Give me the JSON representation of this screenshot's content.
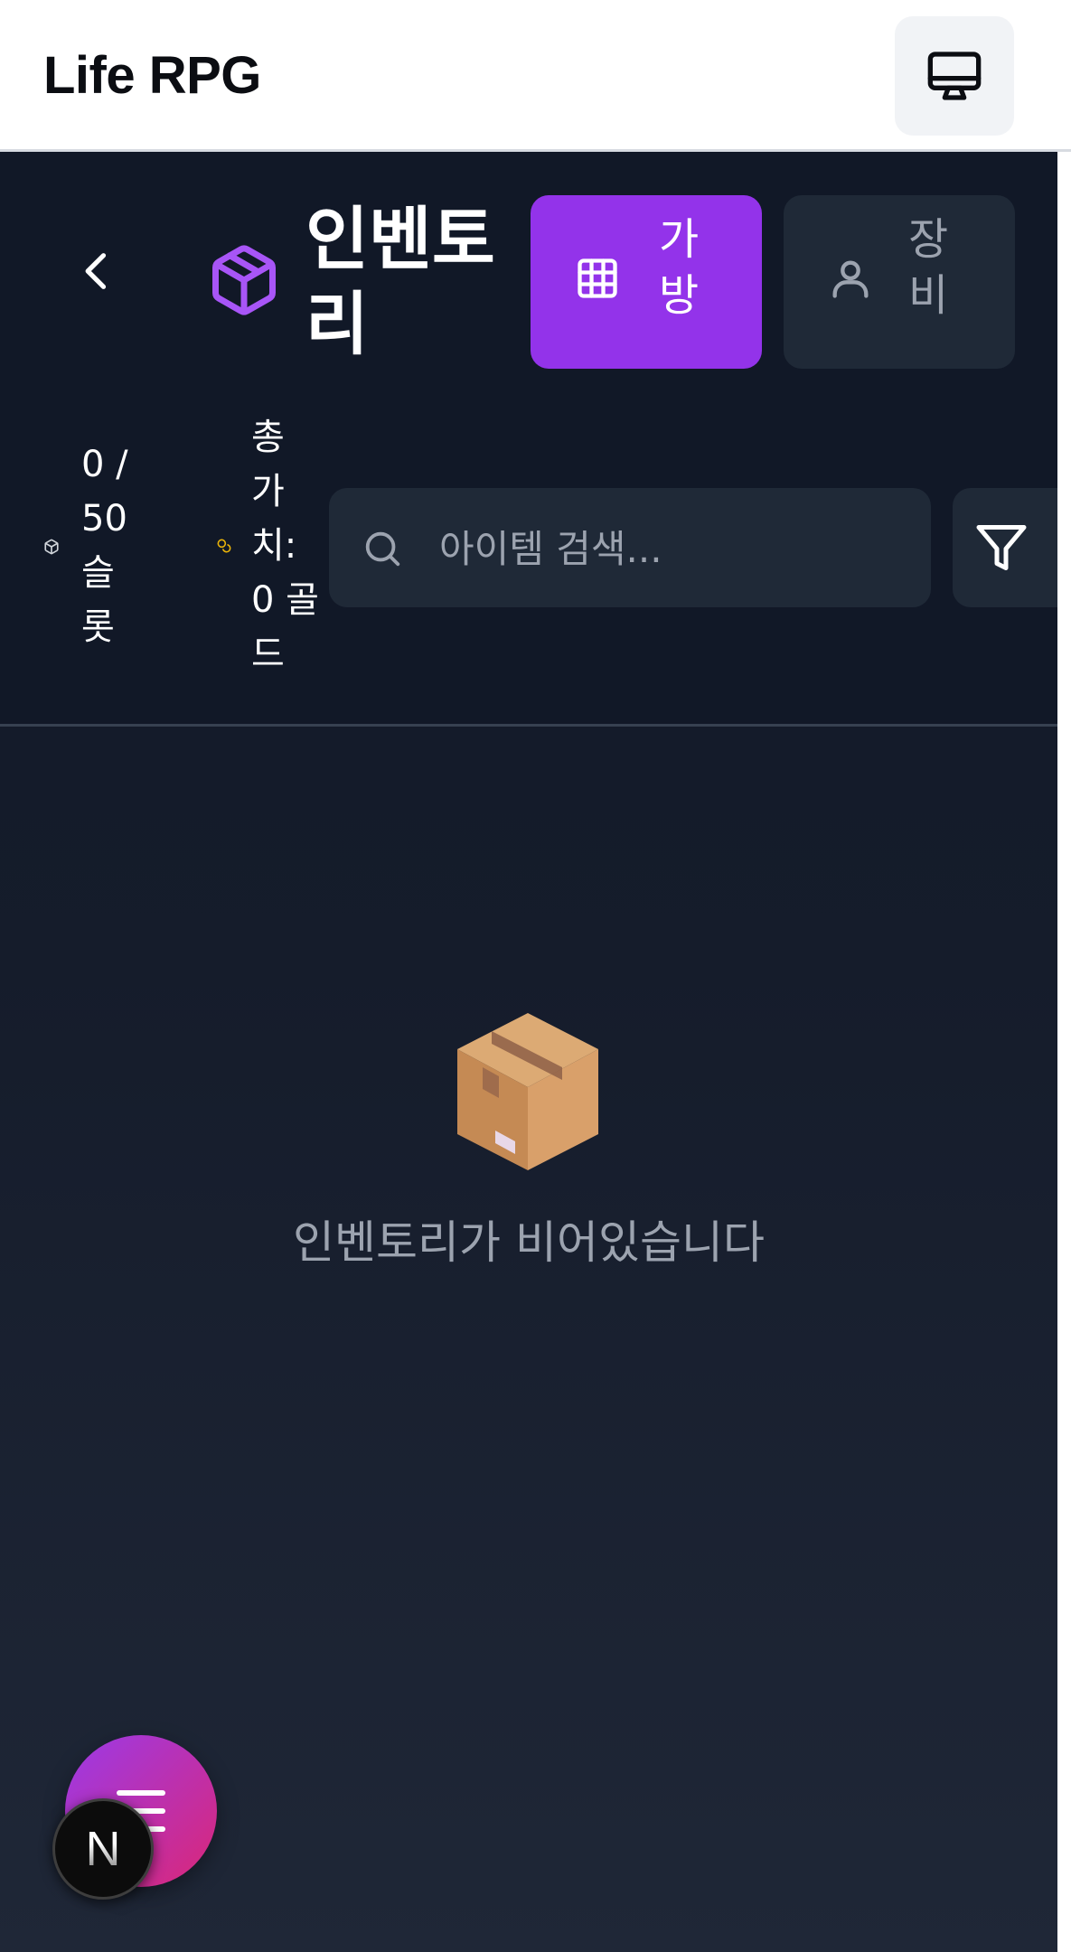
{
  "app": {
    "title": "Life RPG",
    "display_button_icon": "monitor-icon"
  },
  "inventory": {
    "title": "인벤토리",
    "back_icon": "chevron-left-icon",
    "title_icon": "package-icon",
    "accent_color": "#9333ea",
    "tabs": [
      {
        "label": "가방",
        "icon": "grid-icon",
        "active": true
      },
      {
        "label": "장비",
        "icon": "user-icon",
        "active": false
      }
    ],
    "stats": {
      "slots_text": "0 / 50 슬롯",
      "slots_icon": "package-icon",
      "value_text": "총 가치: 0 골드",
      "value_icon": "coins-icon",
      "value_icon_color": "#eab308"
    },
    "search": {
      "placeholder": "아이템 검색...",
      "value": "",
      "icon": "search-icon"
    },
    "filter_icon": "filter-icon",
    "empty_state": {
      "emoji": "📦",
      "message": "인벤토리가 비어있습니다"
    }
  },
  "floating": {
    "menu_icon": "menu-icon",
    "badge_letter": "N"
  }
}
